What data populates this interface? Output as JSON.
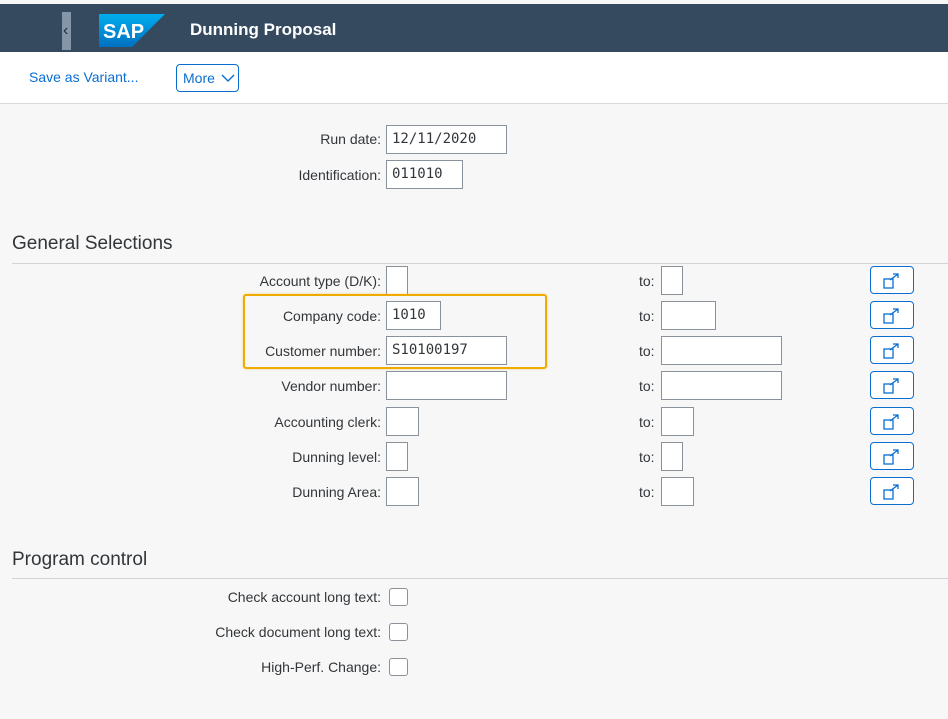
{
  "shell": {
    "title": "Dunning Proposal",
    "logo_text": "SAP",
    "back_glyph": "‹"
  },
  "toolbar": {
    "save_variant": "Save as Variant...",
    "more": "More"
  },
  "header_fields": {
    "run_date": {
      "label": "Run date:",
      "value": "12/11/2020"
    },
    "identification": {
      "label": "Identification:",
      "value": "011010"
    }
  },
  "general": {
    "title": "General Selections",
    "to_label": "to:",
    "rows": [
      {
        "label": "Account type (D/K):",
        "from": "",
        "to": ""
      },
      {
        "label": "Company code:",
        "from": "1010",
        "to": ""
      },
      {
        "label": "Customer number:",
        "from": "S10100197",
        "to": ""
      },
      {
        "label": "Vendor number:",
        "from": "",
        "to": ""
      },
      {
        "label": "Accounting clerk:",
        "from": "",
        "to": ""
      },
      {
        "label": "Dunning level:",
        "from": "",
        "to": ""
      },
      {
        "label": "Dunning Area:",
        "from": "",
        "to": ""
      }
    ]
  },
  "program": {
    "title": "Program control",
    "checks": [
      {
        "label": "Check account long text:",
        "checked": false
      },
      {
        "label": "Check document long text:",
        "checked": false
      },
      {
        "label": "High-Perf. Change:",
        "checked": false
      }
    ]
  },
  "colors": {
    "shell": "#354a5f",
    "link": "#0a6ed1",
    "highlight": "#f0ab00",
    "background": "#f7f7f7"
  },
  "icons": [
    "back-arrow-icon",
    "sap-logo",
    "chevron-down-icon",
    "multiple-selection-icon"
  ]
}
